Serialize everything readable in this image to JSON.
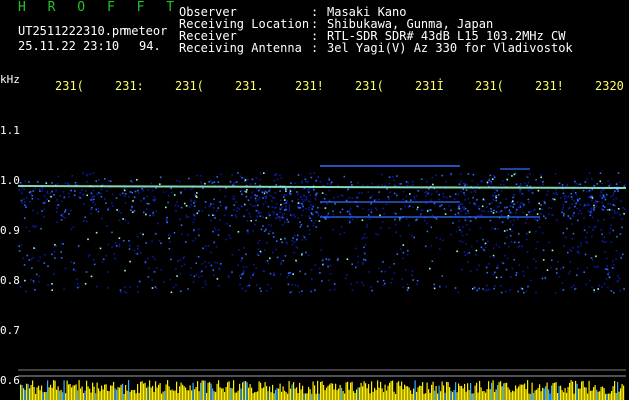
{
  "header": {
    "brand": "H R O F F T",
    "filename": "UT2511222310.pn",
    "mode": "meteor",
    "datetime": "25.11.22 23:10",
    "count": "94.",
    "fields": [
      {
        "label": "Observer",
        "value": "Masaki Kano"
      },
      {
        "label": "Receiving Location",
        "value": "Shibukawa, Gunma, Japan"
      },
      {
        "label": "Receiver",
        "value": "RTL-SDR SDR# 43dB L15 103.2MHz CW"
      },
      {
        "label": "Receiving Antenna",
        "value": "3el Yagi(V) Az 330 for Vladivostok"
      }
    ],
    "separator": ":"
  },
  "spectrogram": {
    "unit": "kHz",
    "y_ticks": [
      "1.1",
      "1.0",
      "0.9",
      "0.8",
      "0.7",
      "0.6"
    ],
    "x_ticks": [
      "231(",
      "231:",
      "231(",
      "231.",
      "231!",
      "231(",
      "231İ",
      "231(",
      "231!",
      "2320"
    ]
  },
  "colors": {
    "brand": "#22c22a",
    "text": "#ffffff",
    "tick_label": "#ffff66",
    "background": "#000000",
    "signal_low": "#0a1aa0",
    "signal_mid": "#2f6cff",
    "signal_high": "#9fffd0",
    "level_bar": "#ffee00"
  }
}
